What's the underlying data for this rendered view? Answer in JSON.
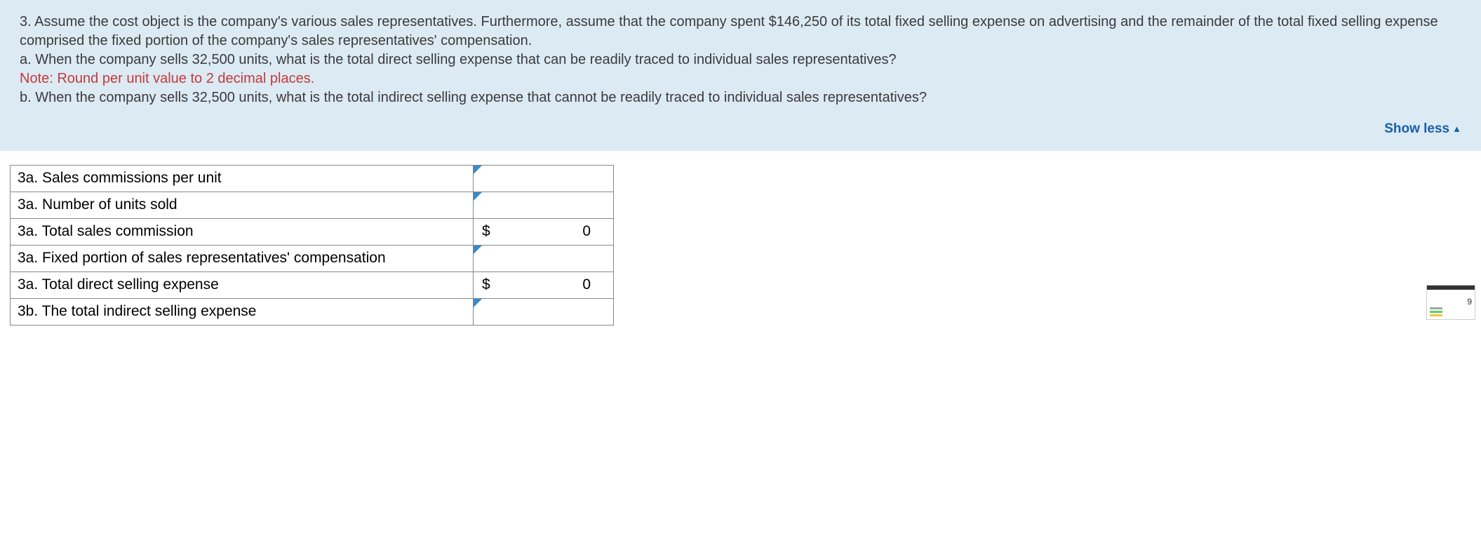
{
  "question": {
    "number": "3.",
    "prompt_main": "Assume the cost object is the company's various sales representatives. Furthermore, assume that the company spent $146,250 of its total fixed selling expense on advertising and the remainder of the total fixed selling expense comprised the fixed portion of the company's sales representatives' compensation.",
    "part_a": "a. When the company sells 32,500 units, what is the total direct selling expense that can be readily traced to individual sales representatives?",
    "note": "Note: Round per unit value to 2 decimal places.",
    "part_b": "b. When the company sells 32,500 units, what is the total indirect selling expense that cannot be readily traced to individual sales representatives?",
    "show_less_label": "Show less"
  },
  "table": {
    "rows": [
      {
        "label": "3a. Sales commissions per unit",
        "type": "input",
        "currency": "",
        "value": ""
      },
      {
        "label": "3a. Number of units sold",
        "type": "input",
        "currency": "",
        "value": ""
      },
      {
        "label": "3a. Total sales commission",
        "type": "calc",
        "currency": "$",
        "value": "0"
      },
      {
        "label": "3a. Fixed portion of sales representatives' compensation",
        "type": "input",
        "currency": "",
        "value": ""
      },
      {
        "label": "3a. Total direct selling expense",
        "type": "calc",
        "currency": "$",
        "value": "0"
      },
      {
        "label": "3b. The total indirect selling expense",
        "type": "input",
        "currency": "",
        "value": ""
      }
    ]
  },
  "thumbnail": {
    "label": "9"
  }
}
